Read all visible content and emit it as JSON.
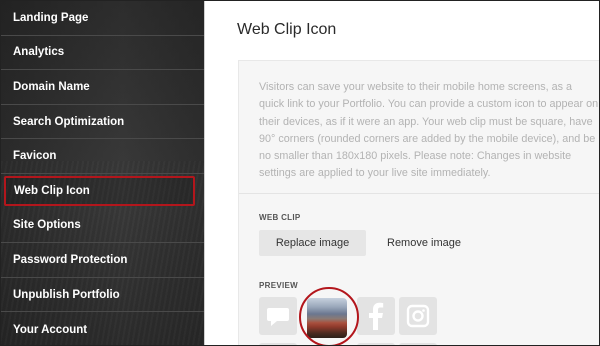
{
  "sidebar": {
    "items": [
      {
        "label": "Landing Page"
      },
      {
        "label": "Analytics"
      },
      {
        "label": "Domain Name"
      },
      {
        "label": "Search Optimization"
      },
      {
        "label": "Favicon"
      },
      {
        "label": "Web Clip Icon",
        "active": true
      },
      {
        "label": "Site Options"
      },
      {
        "label": "Password Protection"
      },
      {
        "label": "Unpublish Portfolio"
      },
      {
        "label": "Your Account"
      }
    ]
  },
  "main": {
    "title": "Web Clip Icon",
    "description": "Visitors can save your website to their mobile home screens, as a quick link to your Portfolio. You can provide a custom icon to appear on their devices, as if it were an app. Your web clip must be square, have 90° corners (rounded corners are added by the mobile device), and be no smaller than 180x180 pixels. Please note: Changes in website settings are applied to your live site immediately.",
    "web_clip_label": "WEB CLIP",
    "replace_button": "Replace image",
    "remove_button": "Remove image",
    "preview_label": "PREVIEW",
    "preview_tiles": [
      "speech-bubble-icon",
      "custom-web-clip-image",
      "facebook-icon",
      "instagram-icon"
    ]
  },
  "colors": {
    "highlight": "#b3161c",
    "sidebar_bg": "#2c2c2c",
    "panel_bg": "#f6f6f6"
  }
}
